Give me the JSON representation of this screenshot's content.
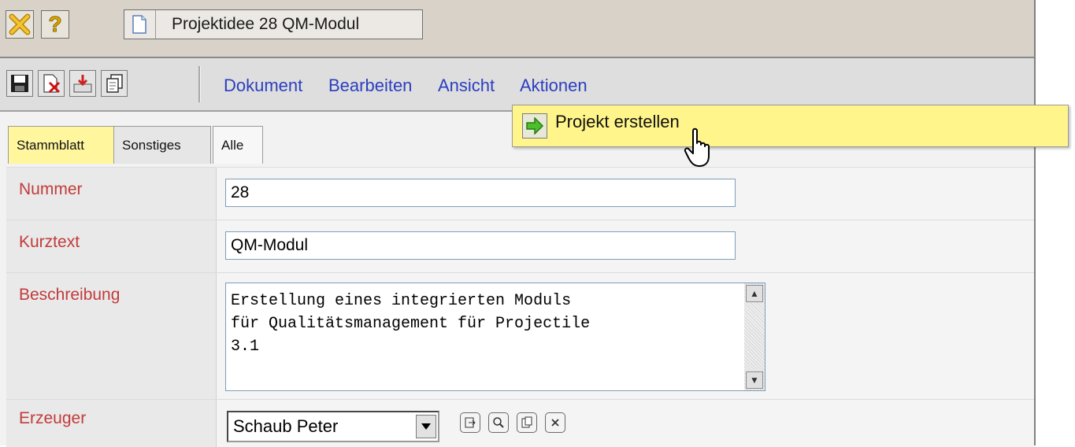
{
  "window": {
    "title": "Projektidee 28 QM-Modul",
    "close_icon": "close-x-icon",
    "help_label": "?"
  },
  "toolbar": {
    "tools": [
      "save-icon",
      "delete-document-icon",
      "export-icon",
      "copy-icon"
    ],
    "menu": [
      {
        "label": "Dokument"
      },
      {
        "label": "Bearbeiten"
      },
      {
        "label": "Ansicht"
      },
      {
        "label": "Aktionen"
      }
    ]
  },
  "popup": {
    "item_label": "Projekt erstellen",
    "icon": "green-arrow-right-icon"
  },
  "tabs": [
    {
      "label": "Stammblatt",
      "state": "active"
    },
    {
      "label": "Sonstiges",
      "state": "inactive"
    },
    {
      "label": "Alle",
      "state": "plain"
    }
  ],
  "form": {
    "nummer": {
      "label": "Nummer",
      "value": "28"
    },
    "kurztext": {
      "label": "Kurztext",
      "value": "QM-Modul"
    },
    "beschreibung": {
      "label": "Beschreibung",
      "value": "Erstellung eines integrierten Moduls\nfür Qualitätsmanagement für Projectile\n3.1"
    },
    "erzeuger": {
      "label": "Erzeuger",
      "value": "Schaub Peter",
      "actions": [
        "select-icon",
        "search-icon",
        "clipboard-icon",
        "clear-icon"
      ]
    }
  },
  "colors": {
    "label_red": "#c23b3b",
    "menu_blue": "#2b3fbf",
    "active_tab": "#fff69e",
    "popup_bg": "#fff58a"
  }
}
